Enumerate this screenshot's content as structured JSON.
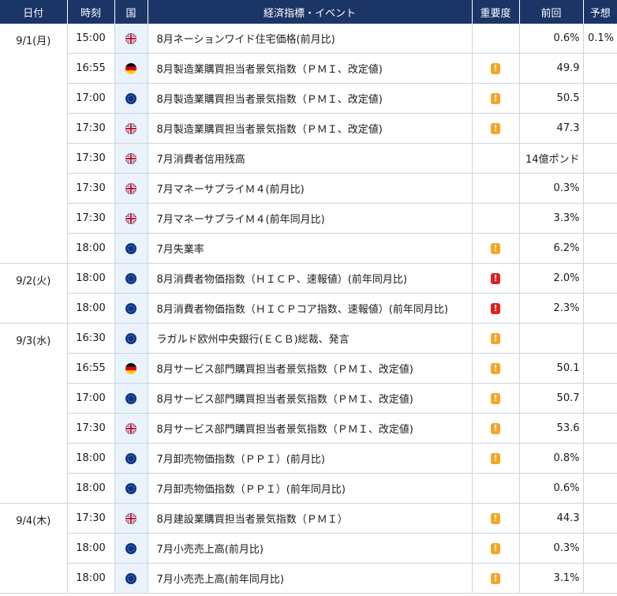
{
  "header": {
    "date": "日付",
    "time": "時刻",
    "country": "国",
    "event": "経済指標・イベント",
    "importance": "重要度",
    "previous": "前回",
    "forecast": "予想"
  },
  "groups": [
    {
      "date": "9/1(月)",
      "rows": [
        {
          "time": "15:00",
          "country": "uk",
          "event": "8月ネーションワイド住宅価格(前月比)",
          "importance": "",
          "previous": "0.6%",
          "forecast": "0.1%"
        },
        {
          "time": "16:55",
          "country": "de",
          "event": "8月製造業購買担当者景気指数（ＰＭＩ、改定値)",
          "importance": "mid",
          "previous": "49.9",
          "forecast": ""
        },
        {
          "time": "17:00",
          "country": "eu",
          "event": "8月製造業購買担当者景気指数（ＰＭＩ、改定値)",
          "importance": "mid",
          "previous": "50.5",
          "forecast": ""
        },
        {
          "time": "17:30",
          "country": "uk",
          "event": "8月製造業購買担当者景気指数（ＰＭＩ、改定値)",
          "importance": "mid",
          "previous": "47.3",
          "forecast": ""
        },
        {
          "time": "17:30",
          "country": "uk",
          "event": "7月消費者信用残高",
          "importance": "",
          "previous": "14億ポンド",
          "forecast": ""
        },
        {
          "time": "17:30",
          "country": "uk",
          "event": "7月マネーサプライＭ４(前月比)",
          "importance": "",
          "previous": "0.3%",
          "forecast": ""
        },
        {
          "time": "17:30",
          "country": "uk",
          "event": "7月マネーサプライＭ４(前年同月比)",
          "importance": "",
          "previous": "3.3%",
          "forecast": ""
        },
        {
          "time": "18:00",
          "country": "eu",
          "event": "7月失業率",
          "importance": "mid",
          "previous": "6.2%",
          "forecast": ""
        }
      ]
    },
    {
      "date": "9/2(火)",
      "rows": [
        {
          "time": "18:00",
          "country": "eu",
          "event": "8月消費者物価指数（ＨＩＣＰ、速報値）(前年同月比)",
          "importance": "high",
          "previous": "2.0%",
          "forecast": ""
        },
        {
          "time": "18:00",
          "country": "eu",
          "event": "8月消費者物価指数（ＨＩＣＰコア指数、速報値）(前年同月比)",
          "importance": "high",
          "previous": "2.3%",
          "forecast": ""
        }
      ]
    },
    {
      "date": "9/3(水)",
      "rows": [
        {
          "time": "16:30",
          "country": "eu",
          "event": "ラガルド欧州中央銀行(ＥＣＢ)総裁、発言",
          "importance": "mid",
          "previous": "",
          "forecast": ""
        },
        {
          "time": "16:55",
          "country": "de",
          "event": "8月サービス部門購買担当者景気指数（ＰＭＩ、改定値)",
          "importance": "mid",
          "previous": "50.1",
          "forecast": ""
        },
        {
          "time": "17:00",
          "country": "eu",
          "event": "8月サービス部門購買担当者景気指数（ＰＭＩ、改定値)",
          "importance": "mid",
          "previous": "50.7",
          "forecast": ""
        },
        {
          "time": "17:30",
          "country": "uk",
          "event": "8月サービス部門購買担当者景気指数（ＰＭＩ、改定値)",
          "importance": "mid",
          "previous": "53.6",
          "forecast": ""
        },
        {
          "time": "18:00",
          "country": "eu",
          "event": "7月卸売物価指数（ＰＰＩ）(前月比)",
          "importance": "mid",
          "previous": "0.8%",
          "forecast": ""
        },
        {
          "time": "18:00",
          "country": "eu",
          "event": "7月卸売物価指数（ＰＰＩ）(前年同月比)",
          "importance": "",
          "previous": "0.6%",
          "forecast": ""
        }
      ]
    },
    {
      "date": "9/4(木)",
      "rows": [
        {
          "time": "17:30",
          "country": "uk",
          "event": "8月建設業購買担当者景気指数（ＰＭＩ）",
          "importance": "mid",
          "previous": "44.3",
          "forecast": ""
        },
        {
          "time": "18:00",
          "country": "eu",
          "event": "7月小売売上高(前月比)",
          "importance": "mid",
          "previous": "0.3%",
          "forecast": ""
        },
        {
          "time": "18:00",
          "country": "eu",
          "event": "7月小売売上高(前年同月比)",
          "importance": "mid",
          "previous": "3.1%",
          "forecast": ""
        }
      ]
    }
  ],
  "importance_badges": {
    "mid": "!",
    "high": "!"
  },
  "colors": {
    "header_bg": "#1b3566",
    "country_bg": "#eaf2fc",
    "grid": "#c8d6e3",
    "importance_mid": "#f5a623",
    "importance_high": "#e02020"
  }
}
